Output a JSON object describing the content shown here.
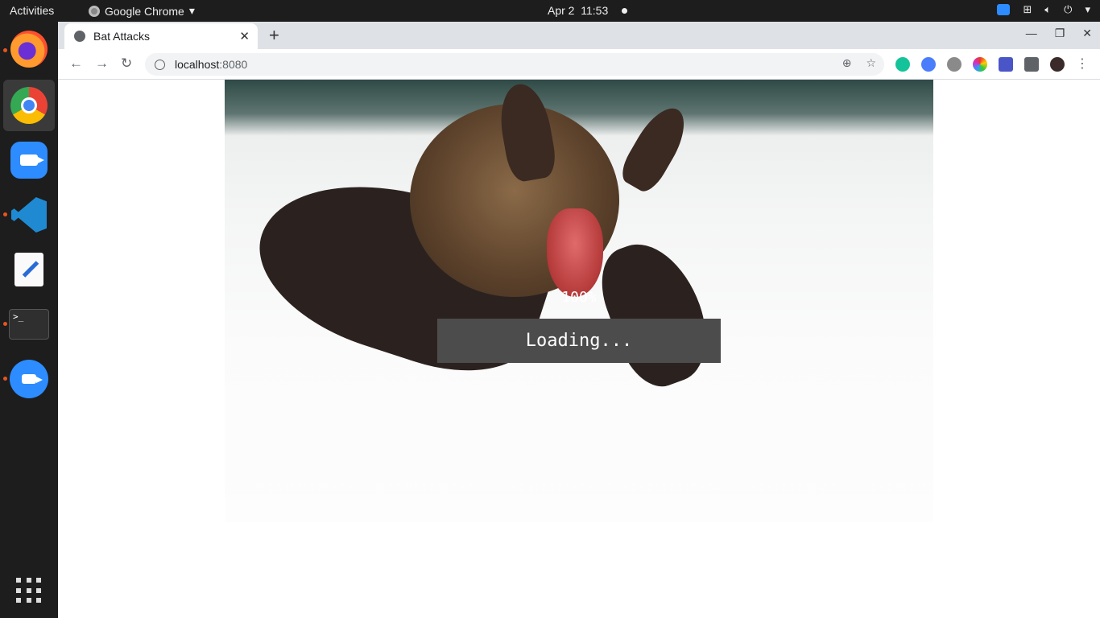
{
  "topbar": {
    "activities": "Activities",
    "app_name": "Google Chrome",
    "date": "Apr 2",
    "time": "11:53"
  },
  "dock": {
    "items": [
      "firefox-icon",
      "chrome-icon",
      "zoom-icon",
      "vscode-icon",
      "text-editor-icon",
      "terminal-icon",
      "zoom-icon",
      "app-grid-icon"
    ],
    "terminal_prompt": ">_"
  },
  "browser": {
    "tab_title": "Bat Attacks",
    "url_host": "localhost",
    "url_port": ":8080"
  },
  "game": {
    "progress_text": "100%",
    "progress": 100,
    "loading_text": "Loading..."
  },
  "colors": {
    "loading_box": "#4c4c4c",
    "dock_bg": "#1d1d1d",
    "topbar_bg": "#1d1d1d"
  }
}
